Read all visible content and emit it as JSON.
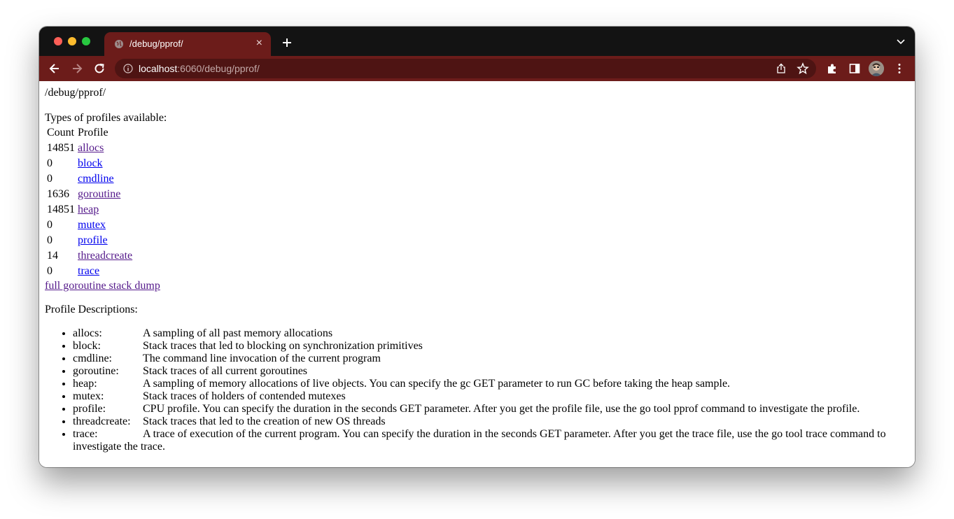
{
  "browser": {
    "tab": {
      "title": "/debug/pprof/"
    },
    "address": {
      "host": "localhost",
      "rest": ":6060/debug/pprof/"
    }
  },
  "page": {
    "heading": "/debug/pprof/",
    "types_heading": "Types of profiles available:",
    "table": {
      "headers": [
        "Count",
        "Profile"
      ],
      "rows": [
        {
          "count": "14851",
          "profile": "allocs",
          "visited": true
        },
        {
          "count": "0",
          "profile": "block",
          "visited": false
        },
        {
          "count": "0",
          "profile": "cmdline",
          "visited": false
        },
        {
          "count": "1636",
          "profile": "goroutine",
          "visited": true
        },
        {
          "count": "14851",
          "profile": "heap",
          "visited": true
        },
        {
          "count": "0",
          "profile": "mutex",
          "visited": false
        },
        {
          "count": "0",
          "profile": "profile",
          "visited": false
        },
        {
          "count": "14",
          "profile": "threadcreate",
          "visited": true
        },
        {
          "count": "0",
          "profile": "trace",
          "visited": false
        }
      ]
    },
    "dump_link": "full goroutine stack dump",
    "descriptions_heading": "Profile Descriptions:",
    "descriptions": [
      {
        "name": "allocs:",
        "text": "A sampling of all past memory allocations"
      },
      {
        "name": "block:",
        "text": "Stack traces that led to blocking on synchronization primitives"
      },
      {
        "name": "cmdline:",
        "text": "The command line invocation of the current program"
      },
      {
        "name": "goroutine:",
        "text": "Stack traces of all current goroutines"
      },
      {
        "name": "heap:",
        "text": "A sampling of memory allocations of live objects. You can specify the gc GET parameter to run GC before taking the heap sample."
      },
      {
        "name": "mutex:",
        "text": "Stack traces of holders of contended mutexes"
      },
      {
        "name": "profile:",
        "text": "CPU profile. You can specify the duration in the seconds GET parameter. After you get the profile file, use the go tool pprof command to investigate the profile."
      },
      {
        "name": "threadcreate:",
        "text": "Stack traces that led to the creation of new OS threads"
      },
      {
        "name": "trace:",
        "text": "A trace of execution of the current program. You can specify the duration in the seconds GET parameter. After you get the trace file, use the go tool trace command to investigate the trace."
      }
    ]
  },
  "colors": {
    "theme": "#6c1c1a",
    "link": "#0000ee",
    "visited_link": "#551a8b"
  }
}
